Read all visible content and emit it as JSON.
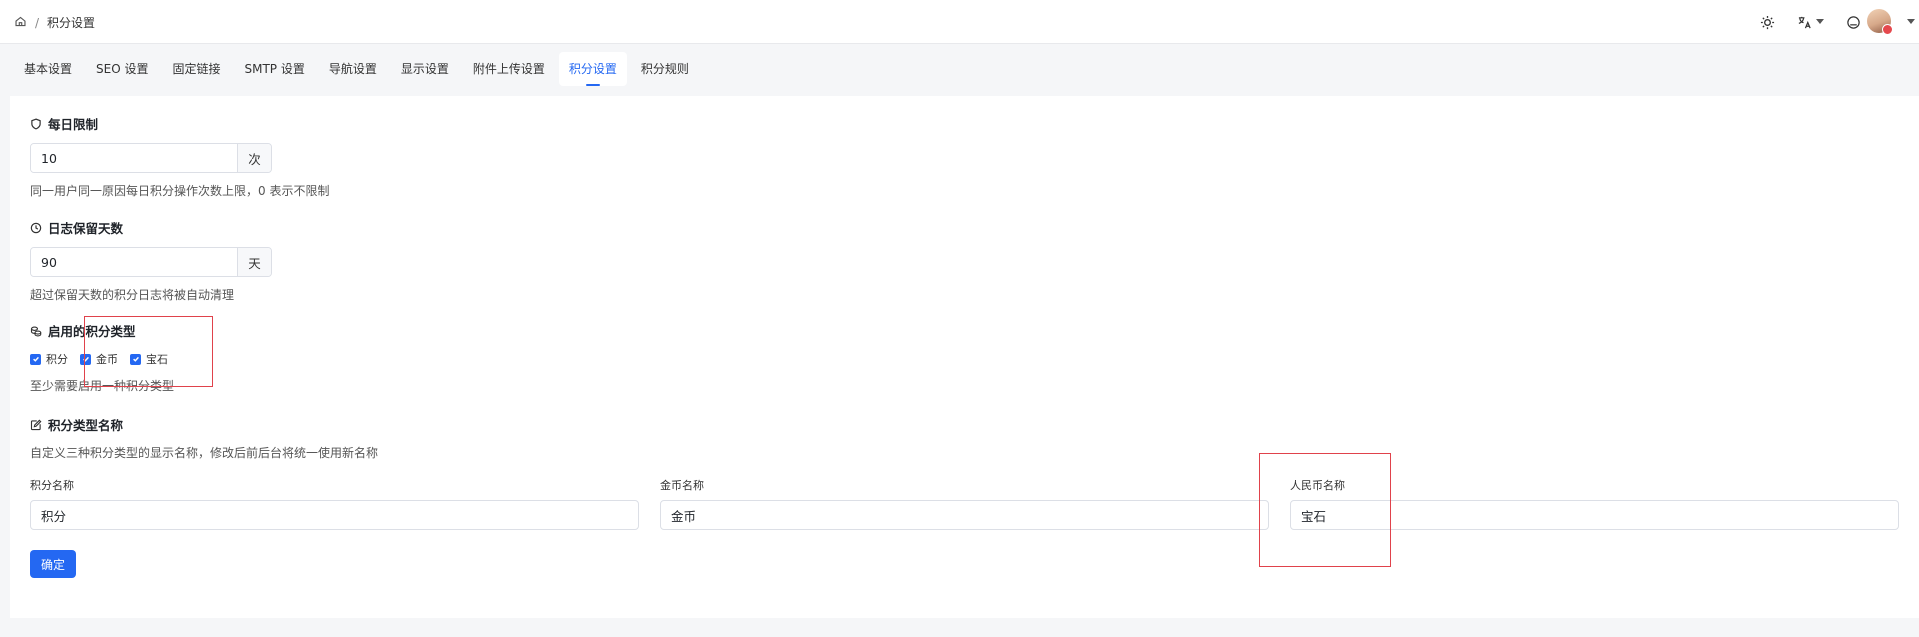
{
  "breadcrumb": {
    "home_icon": "home-icon",
    "separator": "/",
    "current": "积分设置"
  },
  "header_icons": [
    "sun-icon",
    "translate-icon",
    "notification-icon",
    "avatar"
  ],
  "tabs": [
    {
      "label": "基本设置",
      "active": false
    },
    {
      "label": "SEO 设置",
      "active": false
    },
    {
      "label": "固定链接",
      "active": false
    },
    {
      "label": "SMTP 设置",
      "active": false
    },
    {
      "label": "导航设置",
      "active": false
    },
    {
      "label": "显示设置",
      "active": false
    },
    {
      "label": "附件上传设置",
      "active": false
    },
    {
      "label": "积分设置",
      "active": true
    },
    {
      "label": "积分规则",
      "active": false
    }
  ],
  "daily_limit": {
    "title": "每日限制",
    "icon": "shield-icon",
    "value": "10",
    "suffix": "次",
    "hint": "同一用户同一原因每日积分操作次数上限，0 表示不限制"
  },
  "log_retention": {
    "title": "日志保留天数",
    "icon": "clock-icon",
    "value": "90",
    "suffix": "天",
    "hint": "超过保留天数的积分日志将被自动清理"
  },
  "enabled_types": {
    "title": "启用的积分类型",
    "icon": "coins-icon",
    "options": [
      {
        "label": "积分",
        "checked": true
      },
      {
        "label": "金币",
        "checked": true
      },
      {
        "label": "宝石",
        "checked": true
      }
    ],
    "hint": "至少需要启用一种积分类型"
  },
  "type_names": {
    "title": "积分类型名称",
    "icon": "edit-icon",
    "hint": "自定义三种积分类型的显示名称，修改后前后台将统一使用新名称",
    "fields": [
      {
        "label": "积分名称",
        "value": "积分"
      },
      {
        "label": "金币名称",
        "value": "金币"
      },
      {
        "label": "人民币名称",
        "value": "宝石"
      }
    ]
  },
  "confirm_label": "确定",
  "colors": {
    "primary": "#2468f2",
    "highlight": "#e0424b",
    "background": "#f5f6f8"
  }
}
